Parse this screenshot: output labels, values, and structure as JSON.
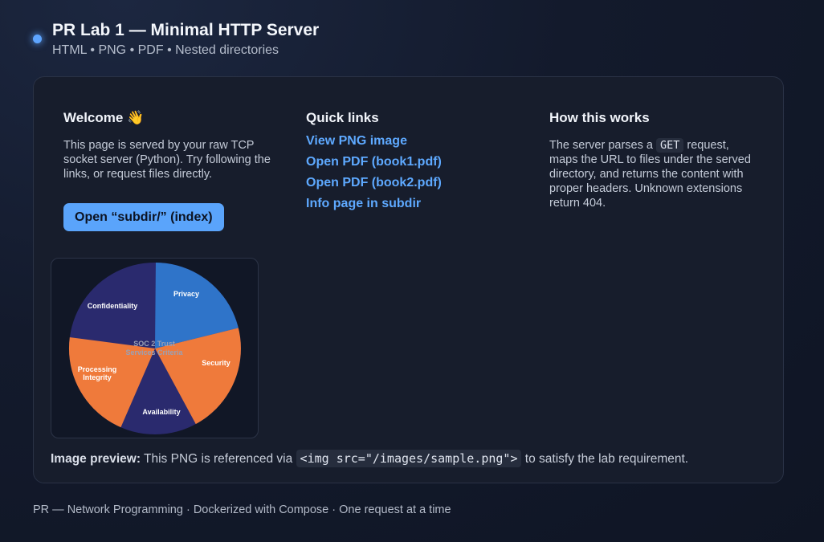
{
  "header": {
    "title": "PR Lab 1 — Minimal HTTP Server",
    "subtitle": "HTML • PNG • PDF • Nested directories"
  },
  "welcome": {
    "heading": "Welcome 👋",
    "text": "This page is served by your raw TCP socket server (Python). Try following the links, or request files directly.",
    "button_label": "Open “subdir/” (index)"
  },
  "quick_links": {
    "heading": "Quick links",
    "items": [
      "View PNG image",
      "Open PDF (book1.pdf)",
      "Open PDF (book2.pdf)",
      "Info page in subdir"
    ]
  },
  "how_it_works": {
    "heading": "How this works",
    "text_before": "The server parses a ",
    "code": "GET",
    "text_after": " request, maps the URL to files under the served directory, and returns the content with proper headers. Unknown extensions return 404."
  },
  "image": {
    "center_line1": "SOC 2 Trust",
    "center_line2": "Services Criteria",
    "privacy": "Privacy",
    "confidentiality": "Confidentiality",
    "security": "Security",
    "processing_line1": "Processing",
    "processing_line2": "Integrity",
    "availability": "Availability",
    "colors": {
      "blue": "#2f74c9",
      "orange": "#ef7a3b",
      "purple": "#2a2a6e"
    }
  },
  "caption": {
    "label": "Image preview:",
    "text_before": " This PNG is referenced via ",
    "code": "<img src=\"/images/sample.png\">",
    "text_after": " to satisfy the lab requirement."
  },
  "footer": "PR — Network Programming · Dockerized with Compose · One request at a time"
}
